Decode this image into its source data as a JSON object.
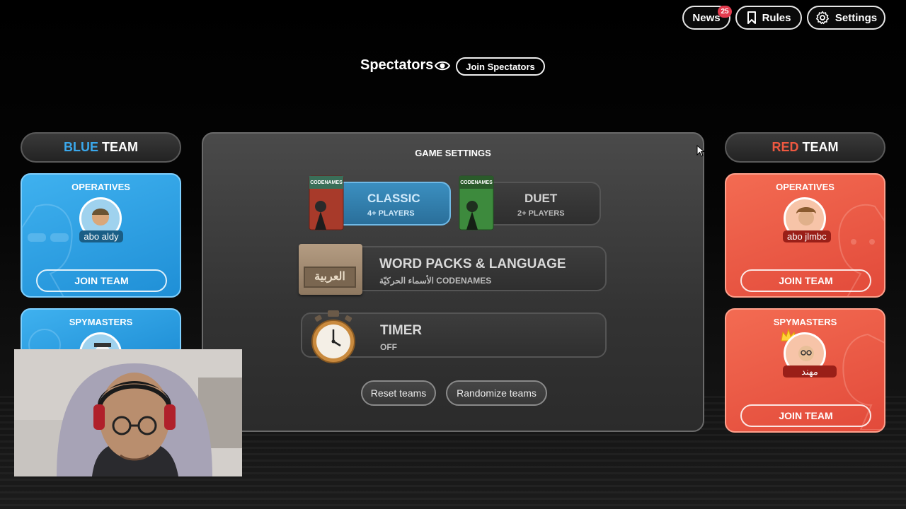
{
  "nav": {
    "news_label": "News",
    "news_badge": "25",
    "rules_label": "Rules",
    "settings_label": "Settings"
  },
  "spectators": {
    "title": "Spectators",
    "join_label": "Join Spectators"
  },
  "blue_team": {
    "title_color_word": "BLUE",
    "title_word": "TEAM",
    "color": "#3aa8ec",
    "operatives": {
      "title": "OPERATIVES",
      "player": "abo aldy",
      "join_label": "JOIN TEAM"
    },
    "spymasters": {
      "title": "SPYMASTERS"
    }
  },
  "red_team": {
    "title_color_word": "RED",
    "title_word": "TEAM",
    "color": "#ee5840",
    "operatives": {
      "title": "OPERATIVES",
      "player": "abo jlmbc",
      "join_label": "JOIN TEAM"
    },
    "spymasters": {
      "title": "SPYMASTERS",
      "player": "مهند",
      "join_label": "JOIN TEAM"
    }
  },
  "game_settings": {
    "title": "GAME SETTINGS",
    "classic": {
      "title": "CLASSIC",
      "sub": "4+ PLAYERS",
      "box_label": "CODENAMES",
      "selected": true
    },
    "duet": {
      "title": "DUET",
      "sub": "2+ PLAYERS",
      "box_label": "CODENAMES"
    },
    "word_packs": {
      "title": "WORD PACKS & LANGUAGE",
      "sub": "الأسماء الحركيّة CODENAMES",
      "flag_text": "العربية"
    },
    "timer": {
      "title": "TIMER",
      "sub": "OFF"
    },
    "reset_label": "Reset teams",
    "randomize_label": "Randomize teams"
  }
}
